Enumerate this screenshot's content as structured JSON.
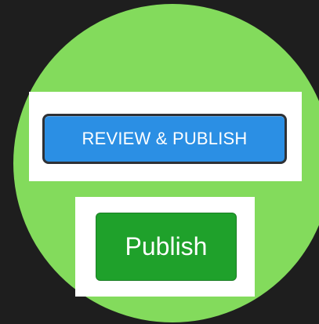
{
  "review_panel": {
    "button_label": "REVIEW & PUBLISH"
  },
  "publish_panel": {
    "button_label": "Publish"
  },
  "colors": {
    "background": "#1e1e1e",
    "circle": "#83db5c",
    "review_button": "#2b8fe4",
    "publish_button": "#1fa12b"
  }
}
